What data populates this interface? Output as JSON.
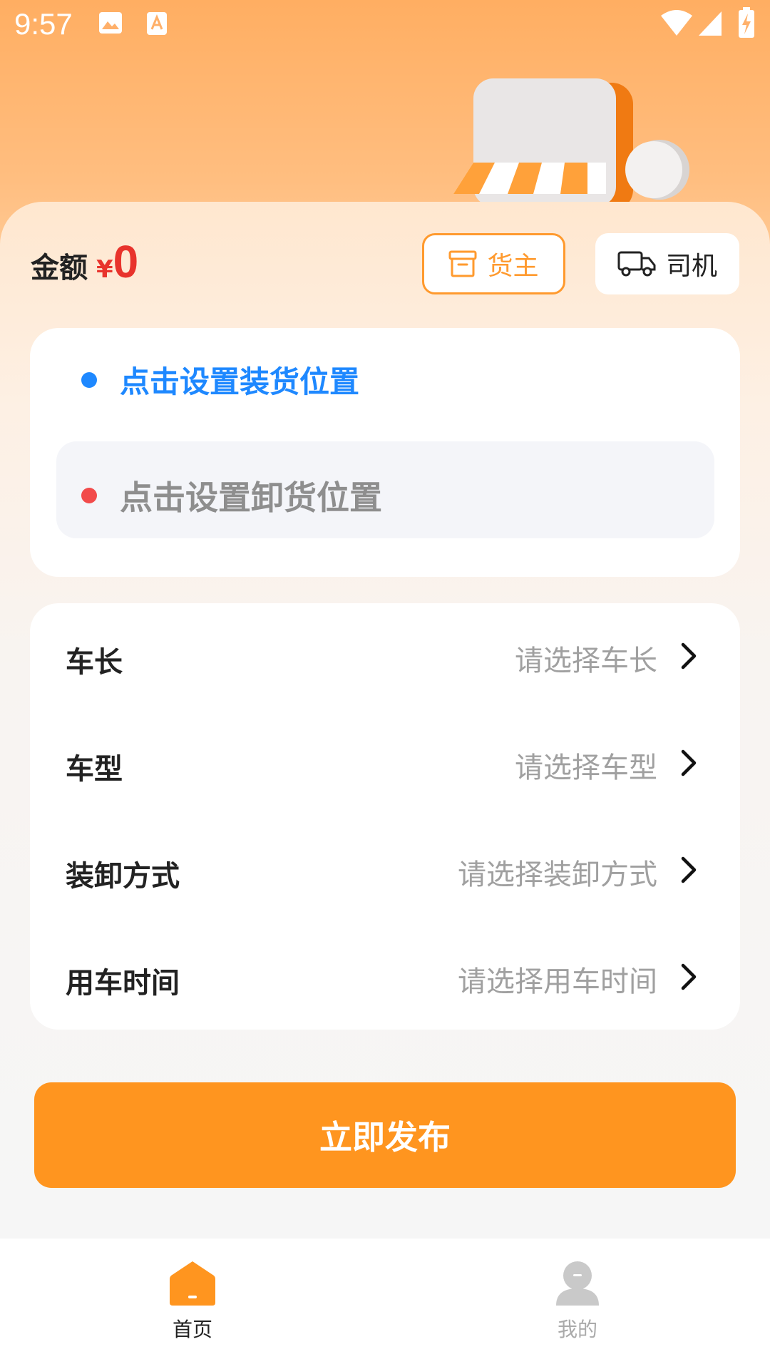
{
  "status_bar": {
    "time": "9:57"
  },
  "amount": {
    "label": "金额",
    "currency": "¥",
    "value": "0"
  },
  "roles": {
    "owner": "货主",
    "driver": "司机",
    "selected": "货主"
  },
  "locations": {
    "load": "点击设置装货位置",
    "unload": "点击设置卸货位置"
  },
  "options": [
    {
      "label": "车长",
      "placeholder": "请选择车长"
    },
    {
      "label": "车型",
      "placeholder": "请选择车型"
    },
    {
      "label": "装卸方式",
      "placeholder": "请选择装卸方式"
    },
    {
      "label": "用车时间",
      "placeholder": "请选择用车时间"
    }
  ],
  "publish_label": "立即发布",
  "tabs": [
    {
      "label": "首页",
      "active": true
    },
    {
      "label": "我的",
      "active": false
    }
  ],
  "colors": {
    "accent": "#ff951f",
    "price": "#e8332c",
    "load_dot": "#1e88ff",
    "unload_dot": "#f24b4b"
  }
}
